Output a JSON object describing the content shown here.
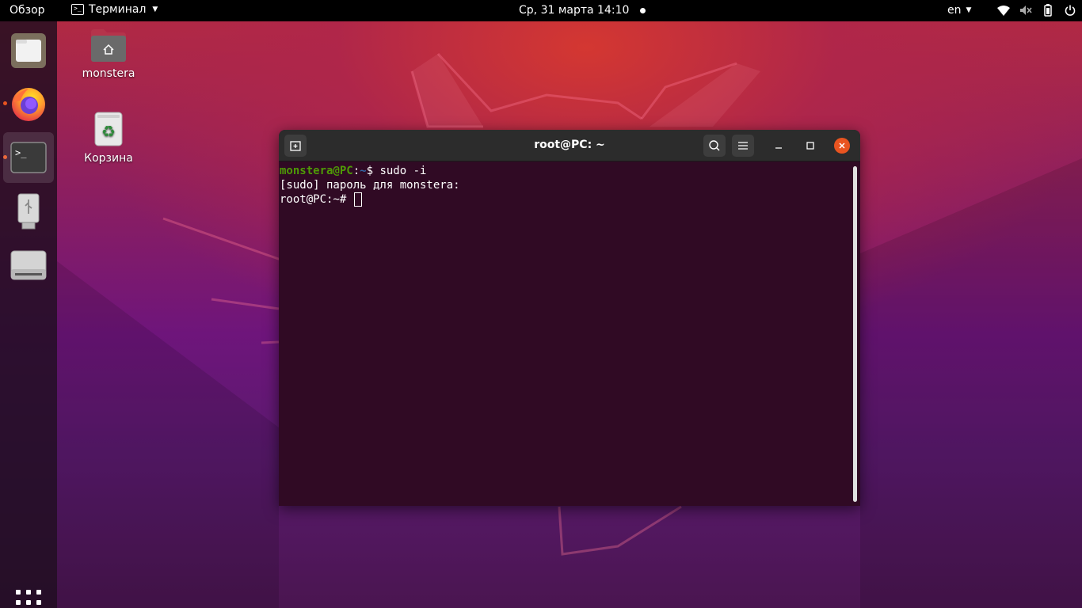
{
  "topbar": {
    "overview": "Обзор",
    "app_name": "Терминал",
    "clock": "Ср, 31 марта  14:10",
    "lang": "en"
  },
  "dock": {
    "items": [
      {
        "name": "files-icon"
      },
      {
        "name": "firefox-icon"
      },
      {
        "name": "terminal-icon"
      },
      {
        "name": "usb-drive-icon"
      },
      {
        "name": "disk-drive-icon"
      }
    ]
  },
  "desktop": {
    "icons": [
      {
        "label": "monstera"
      },
      {
        "label": "Корзина"
      }
    ]
  },
  "terminal": {
    "title": "root@PC: ~",
    "line1": {
      "user": "monstera@PC",
      "sep": ":",
      "path": "~",
      "prompt": "$ ",
      "command": "sudo -i"
    },
    "line2": "[sudo] пароль для monstera:",
    "line3": "root@PC:~# "
  },
  "colors": {
    "accent": "#e95420",
    "terminal_bg": "#300a24",
    "prompt_user": "#4e9a06",
    "prompt_path": "#3465a4"
  }
}
